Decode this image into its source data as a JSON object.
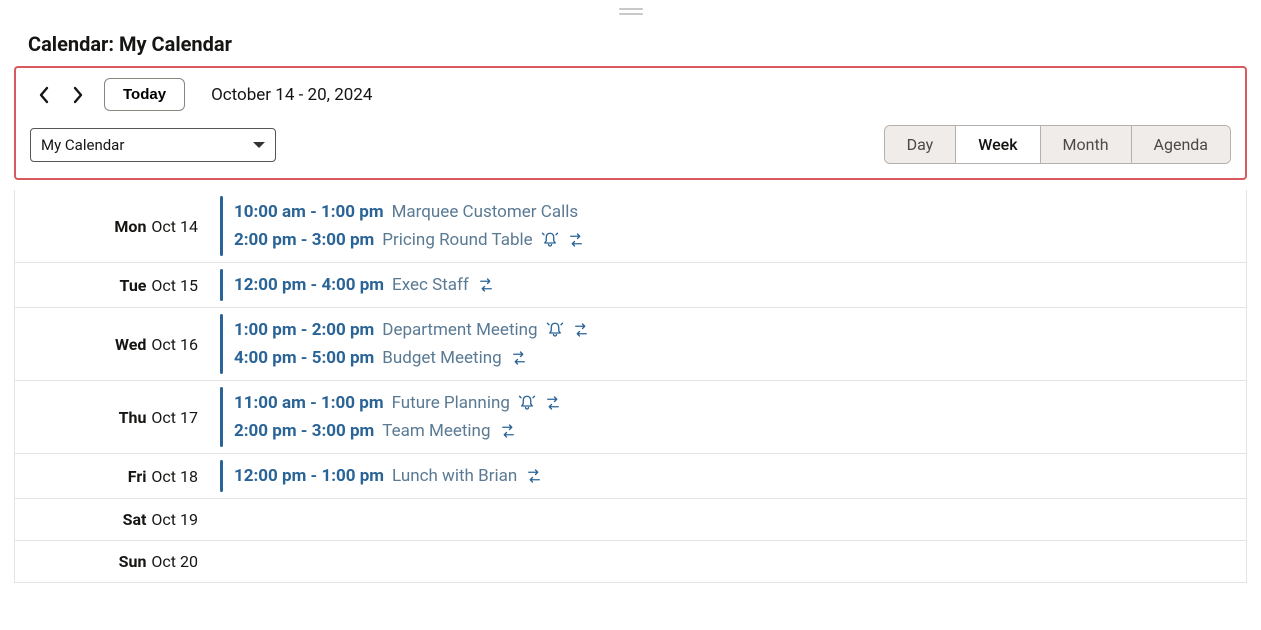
{
  "pageTitle": "Calendar: My Calendar",
  "toolbar": {
    "todayLabel": "Today",
    "dateRange": "October 14 - 20, 2024",
    "selectLabel": "My Calendar",
    "views": {
      "day": "Day",
      "week": "Week",
      "month": "Month",
      "agenda": "Agenda"
    }
  },
  "days": [
    {
      "dow": "Mon",
      "date": "Oct 14",
      "events": [
        {
          "time": "10:00 am - 1:00 pm",
          "title": "Marquee Customer Calls",
          "bell": false,
          "recur": false
        },
        {
          "time": "2:00 pm - 3:00 pm",
          "title": "Pricing Round Table",
          "bell": true,
          "recur": true
        }
      ]
    },
    {
      "dow": "Tue",
      "date": "Oct 15",
      "events": [
        {
          "time": "12:00 pm - 4:00 pm",
          "title": "Exec Staff",
          "bell": false,
          "recur": true
        }
      ]
    },
    {
      "dow": "Wed",
      "date": "Oct 16",
      "events": [
        {
          "time": "1:00 pm - 2:00 pm",
          "title": "Department Meeting",
          "bell": true,
          "recur": true
        },
        {
          "time": "4:00 pm - 5:00 pm",
          "title": "Budget Meeting",
          "bell": false,
          "recur": true
        }
      ]
    },
    {
      "dow": "Thu",
      "date": "Oct 17",
      "events": [
        {
          "time": "11:00 am - 1:00 pm",
          "title": "Future Planning",
          "bell": true,
          "recur": true
        },
        {
          "time": "2:00 pm - 3:00 pm",
          "title": "Team Meeting",
          "bell": false,
          "recur": true
        }
      ]
    },
    {
      "dow": "Fri",
      "date": "Oct 18",
      "events": [
        {
          "time": "12:00 pm - 1:00 pm",
          "title": "Lunch with Brian",
          "bell": false,
          "recur": true
        }
      ]
    },
    {
      "dow": "Sat",
      "date": "Oct 19",
      "events": []
    },
    {
      "dow": "Sun",
      "date": "Oct 20",
      "events": []
    }
  ]
}
